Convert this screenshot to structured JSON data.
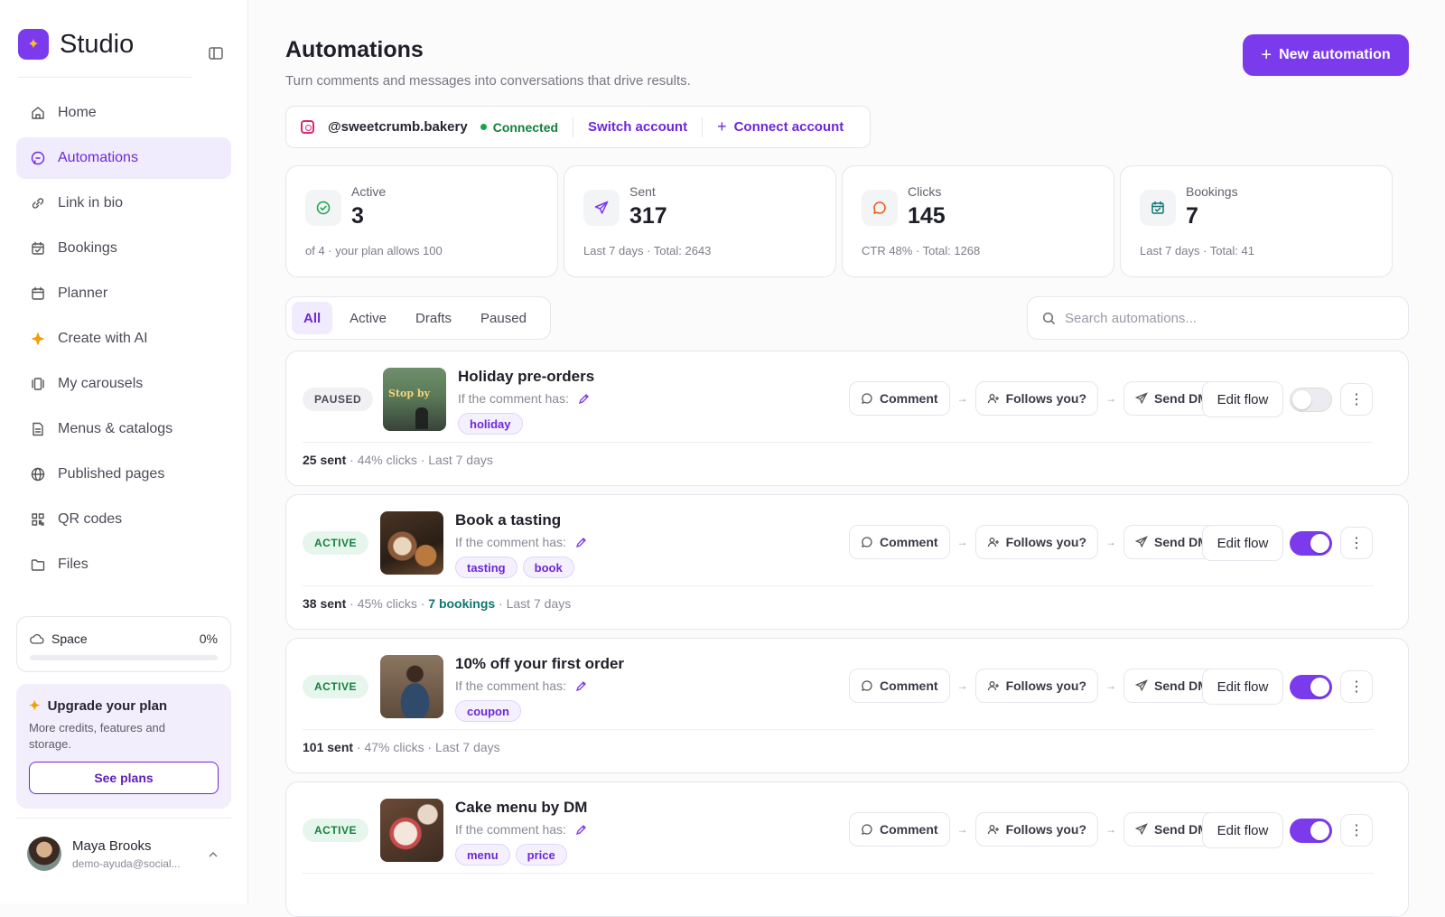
{
  "sidebar": {
    "brand": "Studio",
    "items": [
      {
        "label": "Home",
        "icon": "home-icon",
        "active": false
      },
      {
        "label": "Automations",
        "icon": "chat-bubble-icon",
        "active": true
      },
      {
        "label": "Link in bio",
        "icon": "link-icon",
        "active": false
      },
      {
        "label": "Bookings",
        "icon": "calendar-check-icon",
        "active": false
      },
      {
        "label": "Planner",
        "icon": "calendar-icon",
        "active": false
      },
      {
        "label": "Create with AI",
        "icon": "sparkle-icon",
        "active": false
      },
      {
        "label": "My carousels",
        "icon": "carousel-icon",
        "active": false
      },
      {
        "label": "Menus & catalogs",
        "icon": "document-icon",
        "active": false
      },
      {
        "label": "Published pages",
        "icon": "globe-icon",
        "active": false
      },
      {
        "label": "QR codes",
        "icon": "qr-code-icon",
        "active": false
      },
      {
        "label": "Files",
        "icon": "folder-icon",
        "active": false
      }
    ],
    "space": {
      "label": "Space",
      "percent": "0%",
      "fill": 0
    },
    "upgrade": {
      "title": "Upgrade your plan",
      "text": "More credits, features and storage.",
      "button": "See plans"
    },
    "user": {
      "name": "Maya Brooks",
      "email": "demo-ayuda@social..."
    }
  },
  "header": {
    "title": "Automations",
    "subtitle": "Turn comments and messages into conversations that drive results.",
    "new_button": "New automation"
  },
  "account": {
    "handle": "@sweetcrumb.bakery",
    "status": "Connected",
    "switch": "Switch account",
    "connect": "Connect account"
  },
  "stats": [
    {
      "label": "Active",
      "value": "3",
      "sub": "of 4 · your plan allows 100",
      "icon": "check-circle-icon"
    },
    {
      "label": "Sent",
      "value": "317",
      "sub": "Last 7 days · Total: 2643",
      "icon": "send-icon"
    },
    {
      "label": "Clicks",
      "value": "145",
      "sub": "CTR 48% · Total: 1268",
      "icon": "comment-icon"
    },
    {
      "label": "Bookings",
      "value": "7",
      "sub": "Last 7 days · Total: 41",
      "icon": "calendar-check-icon"
    }
  ],
  "tabs": [
    "All",
    "Active",
    "Drafts",
    "Paused"
  ],
  "search": {
    "placeholder": "Search automations..."
  },
  "flow": {
    "trigger": "Comment",
    "condition": "Follows you?",
    "action": "Send DM"
  },
  "card_labels": {
    "condition": "If the comment has:",
    "edit": "Edit flow"
  },
  "automations": [
    {
      "status": "PAUSED",
      "title": "Holiday pre-orders",
      "tags": [
        "holiday"
      ],
      "enabled": false,
      "sent": "25 sent",
      "stats": " · 44% clicks · Last 7 days",
      "bookings": ""
    },
    {
      "status": "ACTIVE",
      "title": "Book a tasting",
      "tags": [
        "tasting",
        "book"
      ],
      "enabled": true,
      "sent": "38 sent",
      "stats": " · 45% clicks · ",
      "bookings": "7 bookings",
      "stats_tail": " · Last 7 days"
    },
    {
      "status": "ACTIVE",
      "title": "10% off your first order",
      "tags": [
        "coupon"
      ],
      "enabled": true,
      "sent": "101 sent",
      "stats": " · 47% clicks · Last 7 days",
      "bookings": ""
    },
    {
      "status": "ACTIVE",
      "title": "Cake menu by DM",
      "tags": [
        "menu",
        "price"
      ],
      "enabled": true,
      "sent": "",
      "stats": "",
      "bookings": ""
    }
  ],
  "thumb_texts": {
    "holiday": "Stop by"
  }
}
